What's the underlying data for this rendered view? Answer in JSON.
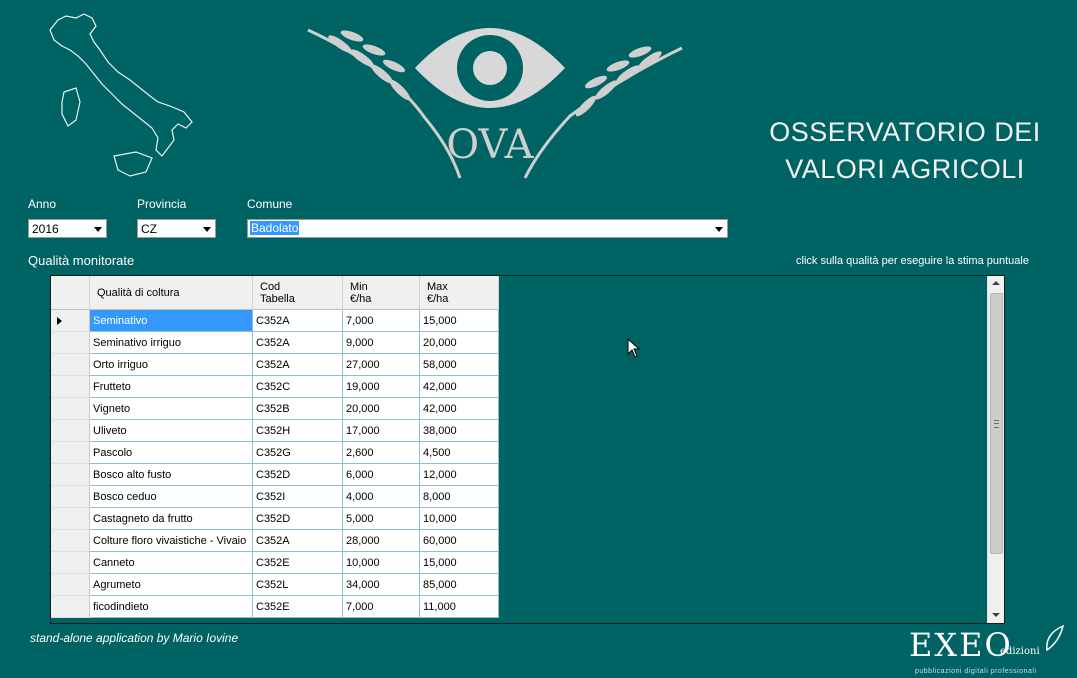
{
  "app": {
    "title_line1": "OSSERVATORIO DEI",
    "title_line2": "VALORI AGRICOLI",
    "logo_text": "OVA"
  },
  "filters": {
    "anno": {
      "label": "Anno",
      "value": "2016"
    },
    "provincia": {
      "label": "Provincia",
      "value": "CZ"
    },
    "comune": {
      "label": "Comune",
      "value": "Badolato"
    }
  },
  "section_label": "Qualità monitorate",
  "hint": "click sulla qualità per eseguire la stima puntuale",
  "grid": {
    "headers": {
      "qualita": "Qualità di coltura",
      "cod_line1": "Cod",
      "cod_line2": "Tabella",
      "min_line1": "Min",
      "min_line2": "€/ha",
      "max_line1": "Max",
      "max_line2": "€/ha"
    },
    "rows": [
      {
        "qualita": "Seminativo",
        "cod": "C352A",
        "min": "7,000",
        "max": "15,000"
      },
      {
        "qualita": "Seminativo irriguo",
        "cod": "C352A",
        "min": "9,000",
        "max": "20,000"
      },
      {
        "qualita": "Orto irriguo",
        "cod": "C352A",
        "min": "27,000",
        "max": "58,000"
      },
      {
        "qualita": "Frutteto",
        "cod": "C352C",
        "min": "19,000",
        "max": "42,000"
      },
      {
        "qualita": "Vigneto",
        "cod": "C352B",
        "min": "20,000",
        "max": "42,000"
      },
      {
        "qualita": "Uliveto",
        "cod": "C352H",
        "min": "17,000",
        "max": "38,000"
      },
      {
        "qualita": "Pascolo",
        "cod": "C352G",
        "min": "2,600",
        "max": "4,500"
      },
      {
        "qualita": "Bosco alto fusto",
        "cod": "C352D",
        "min": "6,000",
        "max": "12,000"
      },
      {
        "qualita": "Bosco ceduo",
        "cod": "C352I",
        "min": "4,000",
        "max": "8,000"
      },
      {
        "qualita": "Castagneto da frutto",
        "cod": "C352D",
        "min": "5,000",
        "max": "10,000"
      },
      {
        "qualita": "Colture floro vivaistiche - Vivaio",
        "cod": "C352A",
        "min": "28,000",
        "max": "60,000"
      },
      {
        "qualita": "Canneto",
        "cod": "C352E",
        "min": "10,000",
        "max": "15,000"
      },
      {
        "qualita": "Agrumeto",
        "cod": "C352L",
        "min": "34,000",
        "max": "85,000"
      },
      {
        "qualita": "ficodindieto",
        "cod": "C352E",
        "min": "7,000",
        "max": "11,000"
      }
    ]
  },
  "footer": {
    "credit": "stand-alone application by Mario Iovine",
    "publisher": "EXEO",
    "publisher_sub": "edizioni",
    "publisher_tagline": "pubblicazioni digitali professionali"
  },
  "colors": {
    "background": "#006363",
    "selection": "#3399ff"
  }
}
